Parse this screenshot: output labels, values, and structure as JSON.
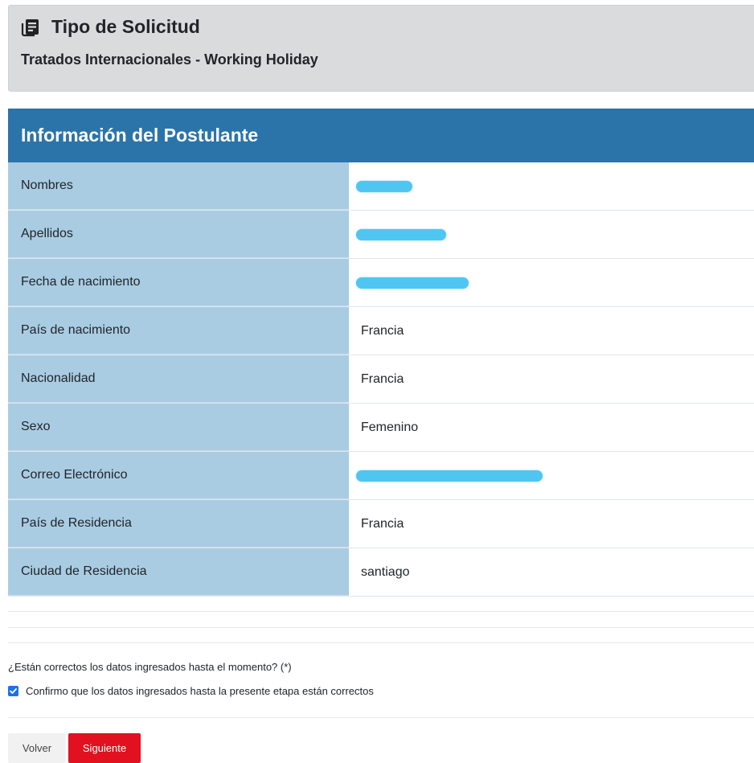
{
  "request": {
    "icon": "newspaper-icon",
    "title": "Tipo de Solicitud",
    "subtitle": "Tratados Internacionales - Working Holiday"
  },
  "applicant": {
    "header": "Información del Postulante",
    "rows": [
      {
        "label": "Nombres",
        "value": ""
      },
      {
        "label": "Apellidos",
        "value": ""
      },
      {
        "label": "Fecha de nacimiento",
        "value": ""
      },
      {
        "label": "País de nacimiento",
        "value": "Francia"
      },
      {
        "label": "Nacionalidad",
        "value": "Francia"
      },
      {
        "label": "Sexo",
        "value": "Femenino"
      },
      {
        "label": "Correo Electrónico",
        "value": ""
      },
      {
        "label": "País de Residencia",
        "value": "Francia"
      },
      {
        "label": "Ciudad de Residencia",
        "value": "santiago"
      }
    ]
  },
  "confirmation": {
    "question": "¿Están correctos los datos ingresados hasta el momento? (*)",
    "checkbox_label": "Confirmo que los datos ingresados hasta la presente etapa están correctos",
    "checked": true
  },
  "actions": {
    "back_label": "Volver",
    "next_label": "Siguiente"
  },
  "colors": {
    "header_bg": "#2b74aa",
    "label_bg": "#a9cce3",
    "next_button": "#e1111f",
    "checkbox": "#1a73e8"
  }
}
